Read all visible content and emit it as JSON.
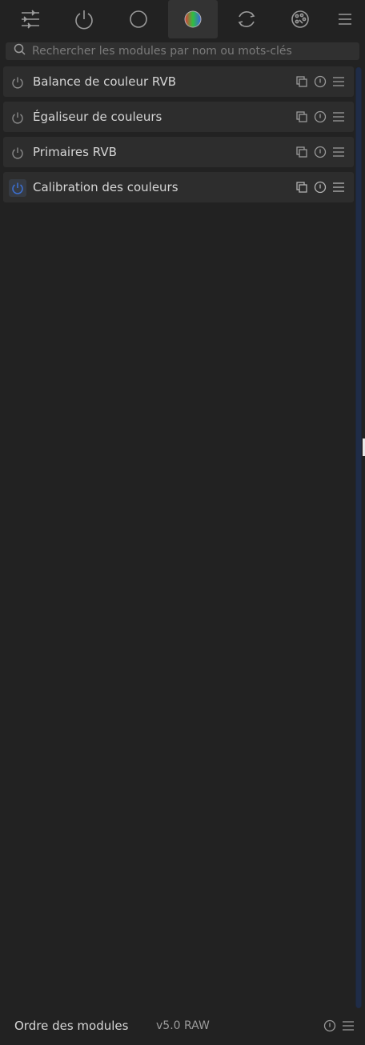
{
  "tabs": [
    {
      "icon": "sliders-icon",
      "active": false
    },
    {
      "icon": "power-icon",
      "active": false
    },
    {
      "icon": "circle-icon",
      "active": false
    },
    {
      "icon": "color-wheel-icon",
      "active": true
    },
    {
      "icon": "refresh-icon",
      "active": false
    },
    {
      "icon": "palette-icon",
      "active": false
    },
    {
      "icon": "menu-icon",
      "active": false
    }
  ],
  "search": {
    "placeholder": "Rechercher les modules par nom ou mots-clés",
    "value": ""
  },
  "modules": [
    {
      "name": "Balance de couleur RVB",
      "enabled": false
    },
    {
      "name": "Égaliseur de couleurs",
      "enabled": false
    },
    {
      "name": "Primaires RVB",
      "enabled": false
    },
    {
      "name": "Calibration des couleurs",
      "enabled": true
    }
  ],
  "footer": {
    "title": "Ordre des modules",
    "preset": "v5.0 RAW"
  },
  "colors": {
    "accent": "#3c6fd0",
    "text": "#d6d6d6",
    "background": "#222222",
    "row": "#2d2d2d"
  }
}
